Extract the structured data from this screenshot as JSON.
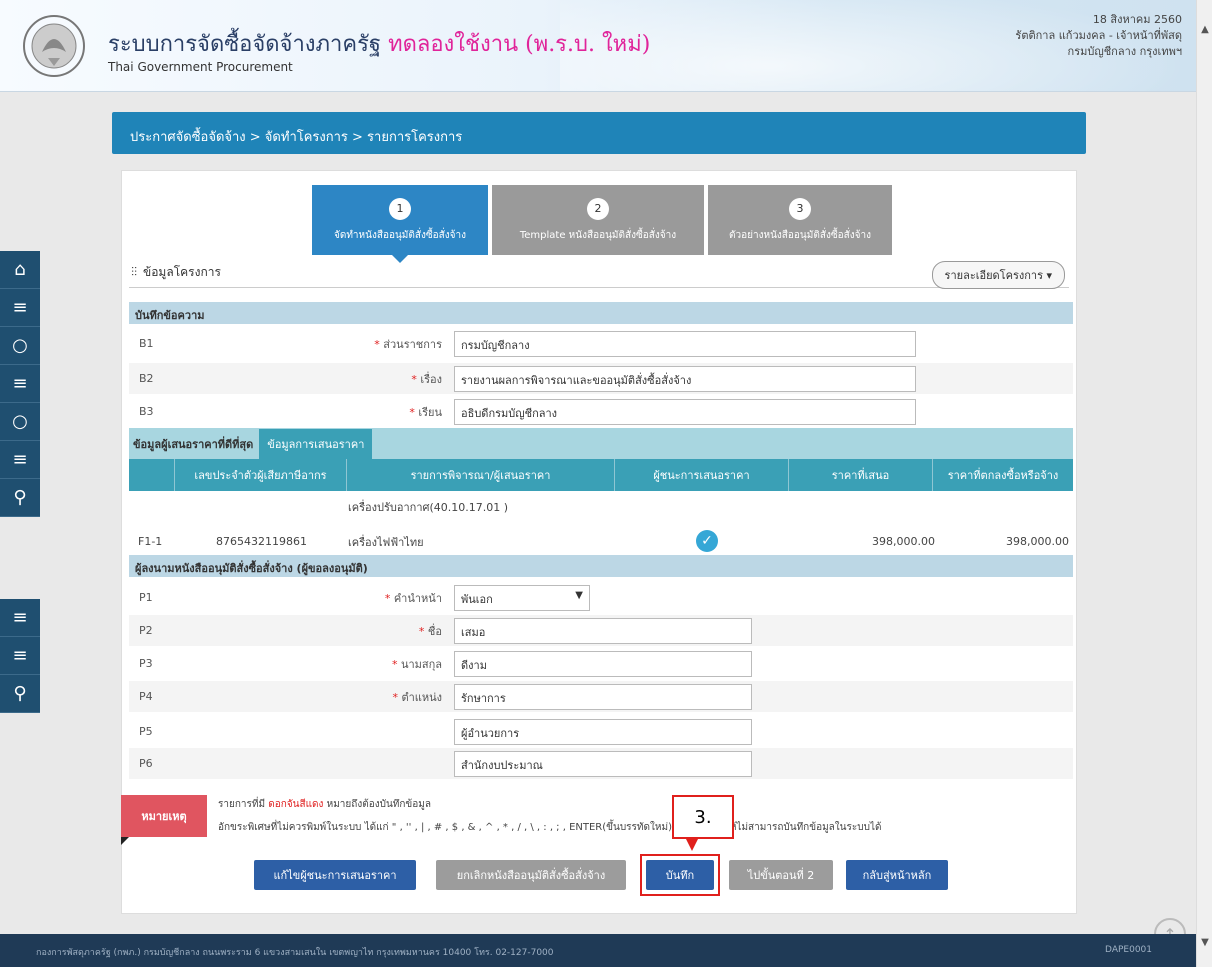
{
  "header": {
    "title": "ระบบการจัดซื้อจัดจ้างภาครัฐ",
    "title_trial": "ทดลองใช้งาน (พ.ร.บ. ใหม่)",
    "subtitle": "Thai Government Procurement",
    "date": "18 สิงหาคม 2560",
    "user": "รัตติกาล แก้วมงคล - เจ้าหน้าที่พัสดุ",
    "org": "กรมบัญชีกลาง กรุงเทพฯ"
  },
  "breadcrumb": "ประกาศจัดซื้อจัดจ้าง > จัดทำโครงการ > รายการโครงการ",
  "steps": [
    {
      "num": "1",
      "label": "จัดทำหนังสืออนุมัติสั่งซื้อสั่งจ้าง"
    },
    {
      "num": "2",
      "label": "Template หนังสืออนุมัติสั่งซื้อสั่งจ้าง"
    },
    {
      "num": "3",
      "label": "ตัวอย่างหนังสืออนุมัติสั่งซื้อสั่งจ้าง"
    }
  ],
  "section": {
    "title": "ข้อมูลโครงการ",
    "detail_button": "รายละเอียดโครงการ ▾"
  },
  "memo": {
    "title": "บันทึกข้อความ",
    "rows": [
      {
        "code": "B1",
        "label": "ส่วนราชการ",
        "value": "กรมบัญชีกลาง"
      },
      {
        "code": "B2",
        "label": "เรื่อง",
        "value": "รายงานผลการพิจารณาและขออนุมัติสั่งซื้อสั่งจ้าง"
      },
      {
        "code": "B3",
        "label": "เรียน",
        "value": "อธิบดีกรมบัญชีกลาง"
      }
    ]
  },
  "winner": {
    "tab1": "ข้อมูลผู้เสนอราคาที่ดีที่สุด",
    "tab2": "ข้อมูลการเสนอราคา",
    "headers": [
      "เลขประจำตัวผู้เสียภาษีอากร",
      "รายการพิจารณา/ผู้เสนอราคา",
      "ผู้ชนะการเสนอราคา",
      "ราคาที่เสนอ",
      "ราคาที่ตกลงซื้อหรือจ้าง"
    ],
    "item_group": "เครื่องปรับอากาศ(40.10.17.01 )",
    "row": {
      "code": "F1-1",
      "tax_id": "8765432119861",
      "vendor": "เครื่องไฟฟ้าไทย",
      "offer": "398,000.00",
      "agreed": "398,000.00"
    }
  },
  "approver": {
    "title": "ผู้ลงนามหนังสืออนุมัติสั่งซื้อสั่งจ้าง (ผู้ขอลงอนุมัติ)",
    "rows": [
      {
        "code": "P1",
        "label": "คำนำหน้า",
        "value": "พันเอก",
        "required": true,
        "select": true
      },
      {
        "code": "P2",
        "label": "ชื่อ",
        "value": "เสมอ",
        "required": true
      },
      {
        "code": "P3",
        "label": "นามสกุล",
        "value": "ดีงาม",
        "required": true
      },
      {
        "code": "P4",
        "label": "ตำแหน่ง",
        "value": "รักษาการ",
        "required": true
      },
      {
        "code": "P5",
        "label": "",
        "value": "ผู้อำนวยการ",
        "required": false
      },
      {
        "code": "P6",
        "label": "",
        "value": "สำนักงบประมาณ",
        "required": false
      }
    ]
  },
  "note": {
    "badge": "หมายเหตุ",
    "line1_a": "รายการที่มี ",
    "line1_red": "ดอกจันสีแดง",
    "line1_b": " หมายถึงต้องบันทึกข้อมูล",
    "line2": "อักขระพิเศษที่ไม่ควรพิมพ์ในระบบ ได้แก่ \" , '' , | , # , $ , & , ^ , * , / , \\ , : , ; , ENTER(ขึ้นบรรทัดใหม่) เพราะจะทำให้ไม่สามารถบันทึกข้อมูลในระบบได้"
  },
  "buttons": {
    "edit_winner": "แก้ไขผู้ชนะการเสนอราคา",
    "cancel_approval": "ยกเลิกหนังสืออนุมัติสั่งซื้อสั่งจ้าง",
    "save": "บันทึก",
    "next_step": "ไปขั้นตอนที่ 2",
    "back_home": "กลับสู่หน้าหลัก"
  },
  "callout": "3.",
  "footer": {
    "address": "กองการพัสดุภาครัฐ (กพภ.) กรมบัญชีกลาง ถนนพระราม 6 แขวงสามเสนใน เขตพญาไท กรุงเทพมหานคร 10400 โทร. 02-127-7000",
    "code": "DAPE0001"
  },
  "colors": {
    "accent": "#1f84b8",
    "nav": "#1f4f70",
    "required": "#e02020",
    "callout": "#e0201c"
  }
}
